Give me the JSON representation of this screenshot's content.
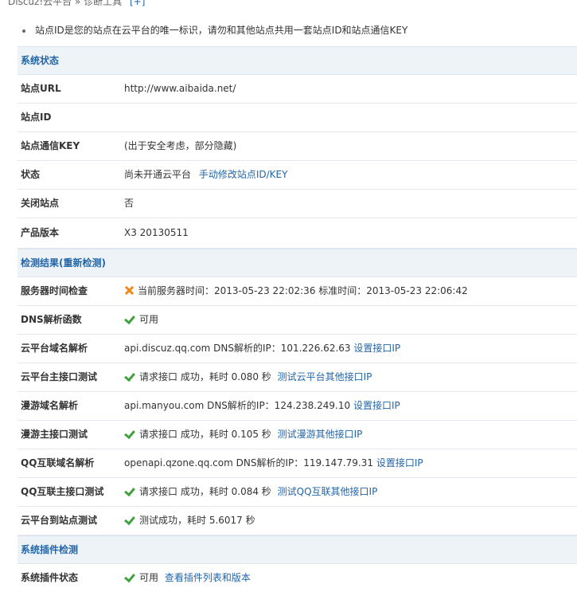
{
  "breadcrumb": {
    "part1": "Discuz!云平台",
    "sep": "»",
    "part2": "诊断工具",
    "plus": "[+]"
  },
  "notice": "站点ID是您的站点在云平台的唯一标识，请勿和其他站点共用一套站点ID和站点通信KEY",
  "status_section": {
    "title": "系统状态",
    "site_url": {
      "label": "站点URL",
      "value": "http://www.aibaida.net/"
    },
    "site_id": {
      "label": "站点ID",
      "value": ""
    },
    "site_key": {
      "label": "站点通信KEY",
      "value": "(出于安全考虑，部分隐藏)"
    },
    "status": {
      "label": "状态",
      "value": "尚未开通云平台",
      "link": "手动修改站点ID/KEY"
    },
    "closed": {
      "label": "关闭站点",
      "value": "否"
    },
    "version": {
      "label": "产品版本",
      "value": "X3 20130511"
    }
  },
  "check_section": {
    "title": "检测结果(重新检测)",
    "time_check": {
      "label": "服务器时间检查",
      "value": "当前服务器时间：2013-05-23 22:02:36 标准时间：2013-05-23 22:06:42"
    },
    "dns": {
      "label": "DNS解析函数",
      "value": "可用"
    },
    "cloud_dns": {
      "label": "云平台域名解析",
      "value": "api.discuz.qq.com DNS解析的IP：101.226.62.63",
      "link": "设置接口IP"
    },
    "cloud_api": {
      "label": "云平台主接口测试",
      "value": "请求接口 成功，耗时 0.080 秒",
      "link": "测试云平台其他接口IP"
    },
    "manyou_dns": {
      "label": "漫游域名解析",
      "value": "api.manyou.com DNS解析的IP：124.238.249.10",
      "link": "设置接口IP"
    },
    "manyou_api": {
      "label": "漫游主接口测试",
      "value": "请求接口 成功，耗时 0.105 秒",
      "link": "测试漫游其他接口IP"
    },
    "qq_dns": {
      "label": "QQ互联域名解析",
      "value": "openapi.qzone.qq.com DNS解析的IP：119.147.79.31",
      "link": "设置接口IP"
    },
    "qq_api": {
      "label": "QQ互联主接口测试",
      "value": "请求接口 成功，耗时 0.084 秒",
      "link": "测试QQ互联其他接口IP"
    },
    "cloud_site": {
      "label": "云平台到站点测试",
      "value": "测试成功，耗时 5.6017 秒"
    }
  },
  "plugin_section": {
    "title": "系统插件检测",
    "plugin_status": {
      "label": "系统插件状态",
      "value": "可用",
      "link": "查看插件列表和版本"
    }
  },
  "colors": {
    "link": "#2366a8",
    "section_bg": "#eef3f8",
    "ok": "#3ea33e",
    "error": "#f08a1c"
  }
}
